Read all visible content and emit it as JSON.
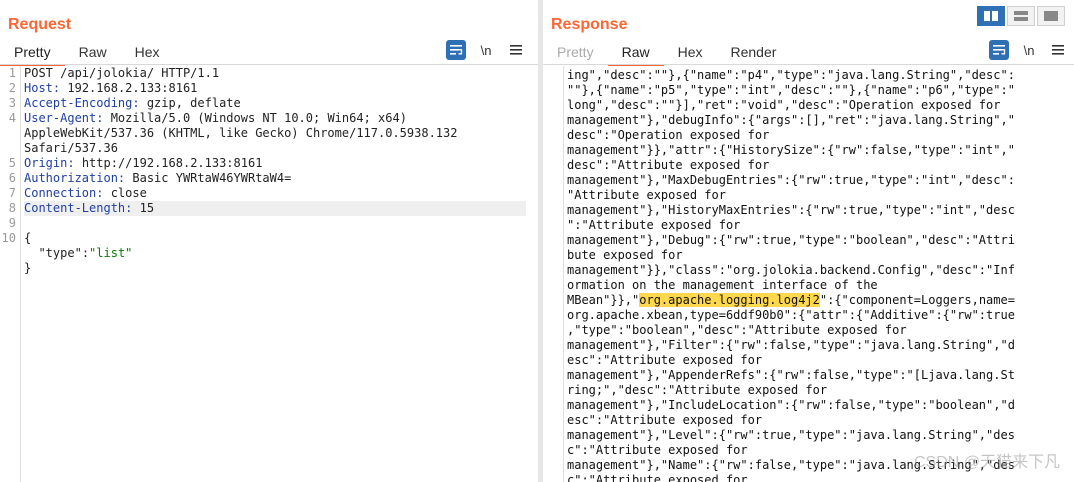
{
  "request": {
    "title": "Request",
    "tabs": [
      {
        "label": "Pretty",
        "active": true
      },
      {
        "label": "Raw",
        "active": false
      },
      {
        "label": "Hex",
        "active": false
      }
    ],
    "tools": {
      "newline_label": "\\n",
      "menu_icon": "hamburger-icon",
      "wrap_icon": "wrap-icon"
    },
    "line_numbers": [
      "1",
      "2",
      "3",
      "4",
      "",
      "",
      "5",
      "6",
      "7",
      "8",
      "9",
      "10",
      "",
      ""
    ],
    "request_line": "POST /api/jolokia/ HTTP/1.1",
    "headers": [
      {
        "name": "Host",
        "value": " 192.168.2.133:8161"
      },
      {
        "name": "Accept-Encoding",
        "value": " gzip, deflate"
      },
      {
        "name": "User-Agent",
        "value": " Mozilla/5.0 (Windows NT 10.0; Win64; x64)"
      },
      {
        "name": "",
        "value": "AppleWebKit/537.36 (KHTML, like Gecko) Chrome/117.0.5938.132"
      },
      {
        "name": "",
        "value": "Safari/537.36"
      },
      {
        "name": "Origin",
        "value": " http://192.168.2.133:8161"
      },
      {
        "name": "Authorization",
        "value": " Basic YWRtaW46YWRtaW4="
      },
      {
        "name": "Connection",
        "value": " close"
      },
      {
        "name": "Content-Length",
        "value": " 15"
      }
    ],
    "body_open": "{",
    "body_key": "\"type\"",
    "body_colon": ":",
    "body_value": "\"list\"",
    "body_close": "}"
  },
  "response": {
    "title": "Response",
    "tabs": [
      {
        "label": "Pretty",
        "active": false,
        "disabled": true
      },
      {
        "label": "Raw",
        "active": true
      },
      {
        "label": "Hex",
        "active": false
      },
      {
        "label": "Render",
        "active": false
      }
    ],
    "tools": {
      "newline_label": "\\n",
      "menu_icon": "hamburger-icon",
      "wrap_icon": "wrap-icon"
    },
    "lines": [
      "ing\",\"desc\":\"\"},{\"name\":\"p4\",\"type\":\"java.lang.String\",\"desc\":",
      "\"\"},{\"name\":\"p5\",\"type\":\"int\",\"desc\":\"\"},{\"name\":\"p6\",\"type\":\"",
      "long\",\"desc\":\"\"}],\"ret\":\"void\",\"desc\":\"Operation exposed for",
      "management\"},\"debugInfo\":{\"args\":[],\"ret\":\"java.lang.String\",\"",
      "desc\":\"Operation exposed for",
      "management\"}},\"attr\":{\"HistorySize\":{\"rw\":false,\"type\":\"int\",\"",
      "desc\":\"Attribute exposed for",
      "management\"},\"MaxDebugEntries\":{\"rw\":true,\"type\":\"int\",\"desc\":",
      "\"Attribute exposed for",
      "management\"},\"HistoryMaxEntries\":{\"rw\":true,\"type\":\"int\",\"desc",
      "\":\"Attribute exposed for",
      "management\"},\"Debug\":{\"rw\":true,\"type\":\"boolean\",\"desc\":\"Attri",
      "bute exposed for",
      "management\"}},\"class\":\"org.jolokia.backend.Config\",\"desc\":\"Inf",
      "ormation on the management interface of the",
      "__HL__",
      "org.apache.xbean,type=6ddf90b0\":{\"attr\":{\"Additive\":{\"rw\":true",
      ",\"type\":\"boolean\",\"desc\":\"Attribute exposed for",
      "management\"},\"Filter\":{\"rw\":false,\"type\":\"java.lang.String\",\"d",
      "esc\":\"Attribute exposed for",
      "management\"},\"AppenderRefs\":{\"rw\":false,\"type\":\"[Ljava.lang.St",
      "ring;\",\"desc\":\"Attribute exposed for",
      "management\"},\"IncludeLocation\":{\"rw\":false,\"type\":\"boolean\",\"d",
      "esc\":\"Attribute exposed for",
      "management\"},\"Level\":{\"rw\":true,\"type\":\"java.lang.String\",\"des",
      "c\":\"Attribute exposed for",
      "management\"},\"Name\":{\"rw\":false,\"type\":\"java.lang.String\",\"des",
      "c\":\"Attribute exposed for"
    ],
    "highlight_line": {
      "before": "MBean\"}},\"",
      "highlight": "org.apache.logging.log4j2",
      "after": "\":{\"component=Loggers,name="
    }
  },
  "watermark": "CSDN @天猫来下凡",
  "colors": {
    "accent": "#ff6633",
    "toolbar_blue": "#2f6fb3",
    "highlight": "#ffd84d",
    "header_name": "#1f3fa3",
    "json_string": "#0a7a0a"
  }
}
